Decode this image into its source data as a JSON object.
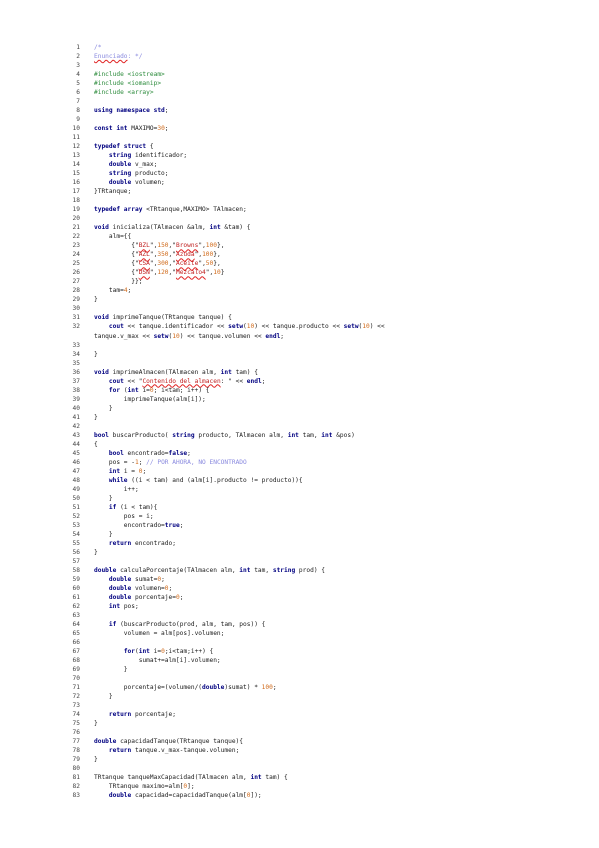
{
  "document": {
    "lines": [
      {
        "n": "1",
        "t": [
          [
            "/*",
            "cm"
          ]
        ]
      },
      {
        "n": "2",
        "t": [
          [
            "Enunciado",
            "cm sq"
          ],
          [
            ": */",
            "cm"
          ]
        ]
      },
      {
        "n": "3",
        "t": []
      },
      {
        "n": "4",
        "t": [
          [
            "#include <iostream>",
            "pp"
          ]
        ]
      },
      {
        "n": "5",
        "t": [
          [
            "#include <iomanip>",
            "pp"
          ]
        ]
      },
      {
        "n": "6",
        "t": [
          [
            "#include <array>",
            "pp"
          ]
        ]
      },
      {
        "n": "7",
        "t": []
      },
      {
        "n": "8",
        "t": [
          [
            "using namespace std",
            "kw"
          ],
          [
            ";",
            ""
          ]
        ]
      },
      {
        "n": "9",
        "t": []
      },
      {
        "n": "10",
        "t": [
          [
            "const int ",
            "kw"
          ],
          [
            "MAXIMO=",
            ""
          ],
          [
            "30",
            "nm"
          ],
          [
            ";",
            ""
          ]
        ]
      },
      {
        "n": "11",
        "t": []
      },
      {
        "n": "12",
        "t": [
          [
            "typedef struct ",
            "kw"
          ],
          [
            "{",
            ""
          ]
        ]
      },
      {
        "n": "13",
        "t": [
          [
            "    ",
            ""
          ],
          [
            "string ",
            "ty"
          ],
          [
            "identificador;",
            ""
          ]
        ]
      },
      {
        "n": "14",
        "t": [
          [
            "    ",
            ""
          ],
          [
            "double ",
            "ty"
          ],
          [
            "v_max;",
            ""
          ]
        ]
      },
      {
        "n": "15",
        "t": [
          [
            "    ",
            ""
          ],
          [
            "string ",
            "ty"
          ],
          [
            "producto;",
            ""
          ]
        ]
      },
      {
        "n": "16",
        "t": [
          [
            "    ",
            ""
          ],
          [
            "double ",
            "ty"
          ],
          [
            "volumen;",
            ""
          ]
        ]
      },
      {
        "n": "17",
        "t": [
          [
            "}TRtanque;",
            ""
          ]
        ]
      },
      {
        "n": "18",
        "t": []
      },
      {
        "n": "19",
        "t": [
          [
            "typedef array ",
            "kw"
          ],
          [
            "<TRtanque,MAXIMO> TAlmacen;",
            ""
          ]
        ]
      },
      {
        "n": "20",
        "t": []
      },
      {
        "n": "21",
        "t": [
          [
            "void ",
            "kw"
          ],
          [
            "inicializa(TAlmacen &alm, ",
            ""
          ],
          [
            "int ",
            "kw"
          ],
          [
            "&tam) {",
            ""
          ]
        ]
      },
      {
        "n": "22",
        "t": [
          [
            "    alm={{",
            ""
          ]
        ]
      },
      {
        "n": "23",
        "t": [
          [
            "          {\"",
            ""
          ],
          [
            "BZL",
            "st sq"
          ],
          [
            "\",",
            ""
          ],
          [
            "150",
            "nm"
          ],
          [
            ",\"",
            ""
          ],
          [
            "Browns",
            "st sq"
          ],
          [
            "\",",
            ""
          ],
          [
            "100",
            "nm"
          ],
          [
            "},",
            ""
          ]
        ]
      },
      {
        "n": "24",
        "t": [
          [
            "          {\"",
            ""
          ],
          [
            "AZL",
            "st sq"
          ],
          [
            "\",",
            ""
          ],
          [
            "350",
            "nm"
          ],
          [
            ",\"",
            ""
          ],
          [
            "Azuda",
            "st sq"
          ],
          [
            "\",",
            ""
          ],
          [
            "100",
            "nm"
          ],
          [
            "},",
            ""
          ]
        ]
      },
      {
        "n": "25",
        "t": [
          [
            "          {\"",
            ""
          ],
          [
            "CSA",
            "st sq"
          ],
          [
            "\",",
            ""
          ],
          [
            "300",
            "nm"
          ],
          [
            ",\"",
            ""
          ],
          [
            "Aceite",
            "st sq"
          ],
          [
            "\",",
            ""
          ],
          [
            "50",
            "nm"
          ],
          [
            "},",
            ""
          ]
        ]
      },
      {
        "n": "26",
        "t": [
          [
            "          {\"",
            ""
          ],
          [
            "DSN",
            "st sq"
          ],
          [
            "\",",
            ""
          ],
          [
            "120",
            "nm"
          ],
          [
            ",\"",
            ""
          ],
          [
            "Mezcalo4",
            "st sq"
          ],
          [
            "\",",
            ""
          ],
          [
            "10",
            "nm"
          ],
          [
            "}",
            ""
          ]
        ]
      },
      {
        "n": "27",
        "t": [
          [
            "          }};",
            ""
          ]
        ]
      },
      {
        "n": "28",
        "t": [
          [
            "    tam=",
            ""
          ],
          [
            "4",
            "nm"
          ],
          [
            ";",
            ""
          ]
        ]
      },
      {
        "n": "29",
        "t": [
          [
            "}",
            ""
          ]
        ]
      },
      {
        "n": "30",
        "t": []
      },
      {
        "n": "31",
        "t": [
          [
            "void ",
            "kw"
          ],
          [
            "imprimeTanque(TRtanque tanque) {",
            ""
          ]
        ]
      },
      {
        "n": "32",
        "t": [
          [
            "    ",
            ""
          ],
          [
            "cout ",
            "kw"
          ],
          [
            "<< tanque.identificador << ",
            ""
          ],
          [
            "setw",
            "kw"
          ],
          [
            "(",
            ""
          ],
          [
            "10",
            "nm"
          ],
          [
            ") << tanque.producto << ",
            ""
          ],
          [
            "setw",
            "kw"
          ],
          [
            "(",
            ""
          ],
          [
            "10",
            "nm"
          ],
          [
            ") <<",
            ""
          ]
        ]
      },
      {
        "n": "",
        "t": [
          [
            "tanque.v_max << ",
            ""
          ],
          [
            "setw",
            "kw"
          ],
          [
            "(",
            ""
          ],
          [
            "10",
            "nm"
          ],
          [
            ") << tanque.volumen << ",
            ""
          ],
          [
            "endl",
            "kw"
          ],
          [
            ";",
            ""
          ]
        ]
      },
      {
        "n": "33",
        "t": []
      },
      {
        "n": "34",
        "t": [
          [
            "}",
            ""
          ]
        ]
      },
      {
        "n": "35",
        "t": []
      },
      {
        "n": "36",
        "t": [
          [
            "void ",
            "kw"
          ],
          [
            "imprimeAlmacen(TAlmacen alm, ",
            ""
          ],
          [
            "int ",
            "kw"
          ],
          [
            "tam) {",
            ""
          ]
        ]
      },
      {
        "n": "37",
        "t": [
          [
            "    ",
            ""
          ],
          [
            "cout ",
            "kw"
          ],
          [
            "<< \"",
            ""
          ],
          [
            "Contenido del almacen",
            "st sq"
          ],
          [
            ": \" << ",
            ""
          ],
          [
            "endl",
            "kw"
          ],
          [
            ";",
            ""
          ]
        ]
      },
      {
        "n": "38",
        "t": [
          [
            "    ",
            ""
          ],
          [
            "for ",
            "kw"
          ],
          [
            "(",
            ""
          ],
          [
            "int ",
            "kw"
          ],
          [
            "i=",
            ""
          ],
          [
            "0",
            "nm"
          ],
          [
            "; i<tam; i++) {",
            ""
          ]
        ]
      },
      {
        "n": "39",
        "t": [
          [
            "        imprimeTanque(alm[i]);",
            ""
          ]
        ]
      },
      {
        "n": "40",
        "t": [
          [
            "    }",
            ""
          ]
        ]
      },
      {
        "n": "41",
        "t": [
          [
            "}",
            ""
          ]
        ]
      },
      {
        "n": "42",
        "t": []
      },
      {
        "n": "43",
        "t": [
          [
            "bool ",
            "kw"
          ],
          [
            "buscarProducto( ",
            ""
          ],
          [
            "string ",
            "ty"
          ],
          [
            "producto, TAlmacen alm, ",
            ""
          ],
          [
            "int ",
            "kw"
          ],
          [
            "tam, ",
            ""
          ],
          [
            "int ",
            "kw"
          ],
          [
            "&pos)",
            ""
          ]
        ]
      },
      {
        "n": "44",
        "t": [
          [
            "{",
            ""
          ]
        ]
      },
      {
        "n": "45",
        "t": [
          [
            "    ",
            ""
          ],
          [
            "bool ",
            "kw"
          ],
          [
            "encontrado=",
            ""
          ],
          [
            "false",
            "kw"
          ],
          [
            ";",
            ""
          ]
        ]
      },
      {
        "n": "46",
        "t": [
          [
            "    pos = -",
            ""
          ],
          [
            "1",
            "nm"
          ],
          [
            "; ",
            ""
          ],
          [
            "// POR AHORA, NO ENCONTRADO",
            "cm"
          ]
        ]
      },
      {
        "n": "47",
        "t": [
          [
            "    ",
            ""
          ],
          [
            "int ",
            "kw"
          ],
          [
            "i = ",
            ""
          ],
          [
            "0",
            "nm"
          ],
          [
            ";",
            ""
          ]
        ]
      },
      {
        "n": "48",
        "t": [
          [
            "    ",
            ""
          ],
          [
            "while ",
            "kw"
          ],
          [
            "((i < tam) and (alm[i].producto != producto)){",
            ""
          ]
        ]
      },
      {
        "n": "49",
        "t": [
          [
            "        i++;",
            ""
          ]
        ]
      },
      {
        "n": "50",
        "t": [
          [
            "    }",
            ""
          ]
        ]
      },
      {
        "n": "51",
        "t": [
          [
            "    ",
            ""
          ],
          [
            "if ",
            "kw"
          ],
          [
            "(i < tam){",
            ""
          ]
        ]
      },
      {
        "n": "52",
        "t": [
          [
            "        pos = i;",
            ""
          ]
        ]
      },
      {
        "n": "53",
        "t": [
          [
            "        encontrado=",
            ""
          ],
          [
            "true",
            "kw"
          ],
          [
            ";",
            ""
          ]
        ]
      },
      {
        "n": "54",
        "t": [
          [
            "    }",
            ""
          ]
        ]
      },
      {
        "n": "55",
        "t": [
          [
            "    ",
            ""
          ],
          [
            "return ",
            "kw"
          ],
          [
            "encontrado;",
            ""
          ]
        ]
      },
      {
        "n": "56",
        "t": [
          [
            "}",
            ""
          ]
        ]
      },
      {
        "n": "57",
        "t": []
      },
      {
        "n": "58",
        "t": [
          [
            "double ",
            "kw"
          ],
          [
            "calculaPorcentaje(TAlmacen alm, ",
            ""
          ],
          [
            "int ",
            "kw"
          ],
          [
            "tam, ",
            ""
          ],
          [
            "string ",
            "ty"
          ],
          [
            "prod) {",
            ""
          ]
        ]
      },
      {
        "n": "59",
        "t": [
          [
            "    ",
            ""
          ],
          [
            "double ",
            "kw"
          ],
          [
            "sumat=",
            ""
          ],
          [
            "0",
            "nm"
          ],
          [
            ";",
            ""
          ]
        ]
      },
      {
        "n": "60",
        "t": [
          [
            "    ",
            ""
          ],
          [
            "double ",
            "kw"
          ],
          [
            "volumen=",
            ""
          ],
          [
            "0",
            "nm"
          ],
          [
            ";",
            ""
          ]
        ]
      },
      {
        "n": "61",
        "t": [
          [
            "    ",
            ""
          ],
          [
            "double ",
            "kw"
          ],
          [
            "porcentaje=",
            ""
          ],
          [
            "0",
            "nm"
          ],
          [
            ";",
            ""
          ]
        ]
      },
      {
        "n": "62",
        "t": [
          [
            "    ",
            ""
          ],
          [
            "int ",
            "kw"
          ],
          [
            "pos;",
            ""
          ]
        ]
      },
      {
        "n": "63",
        "t": []
      },
      {
        "n": "64",
        "t": [
          [
            "    ",
            ""
          ],
          [
            "if ",
            "kw"
          ],
          [
            "(buscarProducto(prod, alm, tam, pos)) {",
            ""
          ]
        ]
      },
      {
        "n": "65",
        "t": [
          [
            "        volumen = alm[pos].volumen;",
            ""
          ]
        ]
      },
      {
        "n": "66",
        "t": []
      },
      {
        "n": "67",
        "t": [
          [
            "        ",
            ""
          ],
          [
            "for",
            "kw"
          ],
          [
            "(",
            ""
          ],
          [
            "int ",
            "kw"
          ],
          [
            "i=",
            ""
          ],
          [
            "0",
            "nm"
          ],
          [
            ";i<tam;i++) {",
            ""
          ]
        ]
      },
      {
        "n": "68",
        "t": [
          [
            "            sumat+=alm[i].volumen;",
            ""
          ]
        ]
      },
      {
        "n": "69",
        "t": [
          [
            "        }",
            ""
          ]
        ]
      },
      {
        "n": "70",
        "t": []
      },
      {
        "n": "71",
        "t": [
          [
            "        porcentaje=(volumen/(",
            ""
          ],
          [
            "double",
            "kw"
          ],
          [
            ")sumat) * ",
            ""
          ],
          [
            "100",
            "nm"
          ],
          [
            ";",
            ""
          ]
        ]
      },
      {
        "n": "72",
        "t": [
          [
            "    }",
            ""
          ]
        ]
      },
      {
        "n": "73",
        "t": []
      },
      {
        "n": "74",
        "t": [
          [
            "    ",
            ""
          ],
          [
            "return ",
            "kw"
          ],
          [
            "porcentaje;",
            ""
          ]
        ]
      },
      {
        "n": "75",
        "t": [
          [
            "}",
            ""
          ]
        ]
      },
      {
        "n": "76",
        "t": []
      },
      {
        "n": "77",
        "t": [
          [
            "double ",
            "kw"
          ],
          [
            "capacidadTanque(TRtanque tanque){",
            ""
          ]
        ]
      },
      {
        "n": "78",
        "t": [
          [
            "    ",
            ""
          ],
          [
            "return ",
            "kw"
          ],
          [
            "tanque.v_max-tanque.volumen;",
            ""
          ]
        ]
      },
      {
        "n": "79",
        "t": [
          [
            "}",
            ""
          ]
        ]
      },
      {
        "n": "80",
        "t": []
      },
      {
        "n": "81",
        "t": [
          [
            "TRtanque tanqueMaxCapacidad(TAlmacen alm, ",
            ""
          ],
          [
            "int ",
            "kw"
          ],
          [
            "tam) {",
            ""
          ]
        ]
      },
      {
        "n": "82",
        "t": [
          [
            "    TRtanque maximo=alm[",
            ""
          ],
          [
            "0",
            "nm"
          ],
          [
            "];",
            ""
          ]
        ]
      },
      {
        "n": "83",
        "t": [
          [
            "    ",
            ""
          ],
          [
            "double ",
            "kw"
          ],
          [
            "capacidad=capacidadTanque(alm[",
            ""
          ],
          [
            "0",
            "nm"
          ],
          [
            "]);",
            ""
          ]
        ]
      }
    ]
  }
}
